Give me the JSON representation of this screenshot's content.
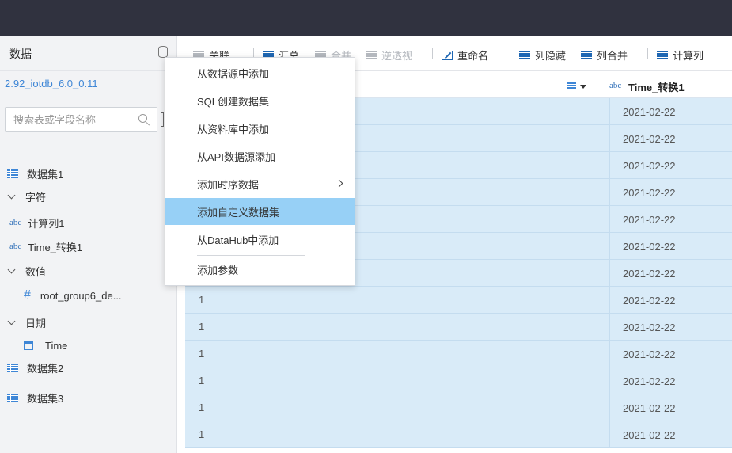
{
  "sidebar": {
    "title": "数据",
    "connection": "2.92_iotdb_6.0_0.11",
    "search_placeholder": "搜索表或字段名称",
    "items": [
      {
        "label": "数据集1"
      },
      {
        "label": "字符"
      },
      {
        "label": "计算列1",
        "type": "abc"
      },
      {
        "label": "Time_转换1",
        "type": "abc"
      },
      {
        "label": "数值"
      },
      {
        "label": "root_group6_de...",
        "type": "#"
      },
      {
        "label": "日期"
      },
      {
        "label": "Time"
      },
      {
        "label": "数据集2"
      },
      {
        "label": "数据集3"
      }
    ]
  },
  "toolbar": {
    "items": [
      {
        "label": "关联"
      },
      {
        "label": "汇总"
      },
      {
        "label": "合并"
      },
      {
        "label": "逆透视"
      },
      {
        "label": "重命名"
      },
      {
        "label": "列隐藏"
      },
      {
        "label": "列合并"
      },
      {
        "label": "计算列"
      }
    ]
  },
  "grid": {
    "column_type": "abc",
    "column_title": "Time_转换1",
    "rows": [
      {
        "c1": "",
        "c2": "2021-02-22"
      },
      {
        "c1": "",
        "c2": "2021-02-22"
      },
      {
        "c1": "",
        "c2": "2021-02-22"
      },
      {
        "c1": "",
        "c2": "2021-02-22"
      },
      {
        "c1": "",
        "c2": "2021-02-22"
      },
      {
        "c1": "",
        "c2": "2021-02-22"
      },
      {
        "c1": "",
        "c2": "2021-02-22"
      },
      {
        "c1": "1",
        "c2": "2021-02-22"
      },
      {
        "c1": "1",
        "c2": "2021-02-22"
      },
      {
        "c1": "1",
        "c2": "2021-02-22"
      },
      {
        "c1": "1",
        "c2": "2021-02-22"
      },
      {
        "c1": "1",
        "c2": "2021-02-22"
      },
      {
        "c1": "1",
        "c2": "2021-02-22"
      }
    ]
  },
  "context_menu": {
    "items": [
      {
        "label": "从数据源中添加"
      },
      {
        "label": "SQL创建数据集"
      },
      {
        "label": "从资料库中添加"
      },
      {
        "label": "从API数据源添加"
      },
      {
        "label": "添加时序数据"
      },
      {
        "label": "添加自定义数据集"
      },
      {
        "label": "从DataHub中添加"
      },
      {
        "label": "添加参数"
      }
    ]
  },
  "colors": {
    "topbar": "#30323f",
    "accent": "#3e86d6",
    "row_selected": "#d9ebf8",
    "menu_active": "#97d0f6"
  }
}
